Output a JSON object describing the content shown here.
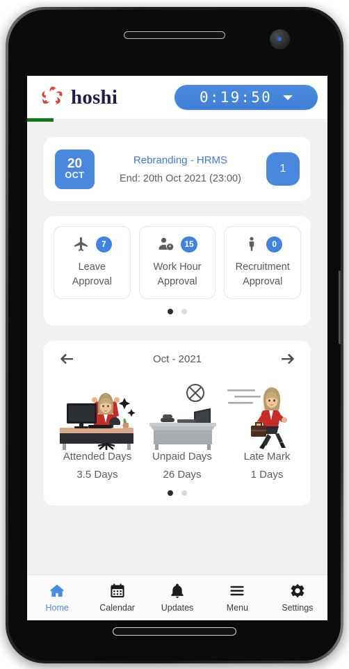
{
  "header": {
    "brand_name": "hoshi",
    "brand_logo_icon": "hoshi-starburst-icon",
    "timer_value": "0:19:50",
    "timer_caret_icon": "chevron-down-icon"
  },
  "task_card": {
    "date_day": "20",
    "date_month": "OCT",
    "title": "Rebranding - HRMS",
    "subtitle": "End: 20th Oct 2021 (23:00)",
    "count": "1"
  },
  "approvals": {
    "items": [
      {
        "icon": "airplane-icon",
        "badge": "7",
        "line1": "Leave",
        "line2": "Approval"
      },
      {
        "icon": "person-clock-icon",
        "badge": "15",
        "line1": "Work Hour",
        "line2": "Approval"
      },
      {
        "icon": "person-icon",
        "badge": "0",
        "line1": "Recruitment",
        "line2": "Approval"
      }
    ],
    "pagination": {
      "count": 2,
      "active_index": 0
    }
  },
  "attendance": {
    "prev_icon": "arrow-left-icon",
    "next_icon": "arrow-right-icon",
    "month_label": "Oct - 2021",
    "stats": [
      {
        "art": "happy-employee-at-desk-illustration",
        "label": "Attended Days",
        "value": "3.5 Days"
      },
      {
        "art": "empty-desk-absent-illustration",
        "label": "Unpaid Days",
        "value": "26 Days"
      },
      {
        "art": "running-late-employee-illustration",
        "label": "Late Mark",
        "value": "1 Days"
      }
    ],
    "pagination": {
      "count": 2,
      "active_index": 0
    }
  },
  "bottom_nav": {
    "items": [
      {
        "icon": "home-icon",
        "label": "Home",
        "active": true
      },
      {
        "icon": "calendar-icon",
        "label": "Calendar",
        "active": false
      },
      {
        "icon": "bell-icon",
        "label": "Updates",
        "active": false
      },
      {
        "icon": "menu-icon",
        "label": "Menu",
        "active": false
      },
      {
        "icon": "gear-icon",
        "label": "Settings",
        "active": false
      }
    ]
  },
  "colors": {
    "accent_blue": "#4a88dd",
    "link_blue": "#3a7ae0",
    "brand_navy": "#241b4e",
    "brand_red": "#d6483b",
    "progress_green": "#0e7a18",
    "screen_bg": "#f1f1f4"
  }
}
